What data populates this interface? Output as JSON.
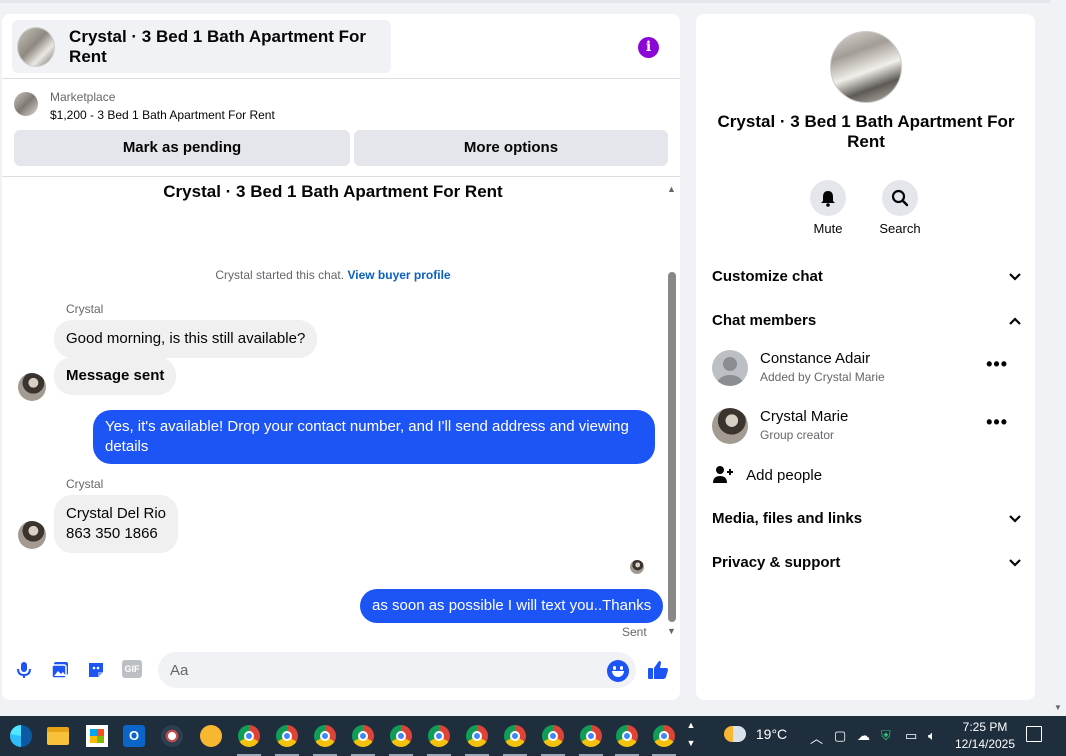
{
  "chat": {
    "header_title": "Crystal · 3 Bed 1 Bath Apartment For Rent",
    "listing_source": "Marketplace",
    "listing_price_title": "$1,200 - 3 Bed 1 Bath Apartment For Rent",
    "mark_pending_label": "Mark as pending",
    "more_options_label": "More options",
    "conversation_title": "Crystal · 3 Bed 1 Bath Apartment For Rent",
    "started_text": "Crystal started this chat.",
    "view_buyer_profile": "View buyer profile",
    "messages": [
      {
        "sender": "Crystal",
        "text": "Good morning, is this still available?"
      },
      {
        "text": "Message sent"
      },
      {
        "text": "Yes, it's available! Drop your contact number, and I'll send address and viewing details"
      },
      {
        "sender": "Crystal",
        "line1": "Crystal Del Rio",
        "line2": "863 350 1866"
      },
      {
        "text": "as soon as possible I will text you..Thanks"
      }
    ],
    "status": "Sent",
    "input_placeholder": "Aa",
    "composer_icons": [
      "microphone-icon",
      "photo-icon",
      "sticker-icon",
      "gif-icon",
      "emoji-icon",
      "thumbs-up-icon"
    ],
    "gif_label": "GIF",
    "accent_color": "#1d54f5",
    "info_color": "#8a07d6"
  },
  "info_panel": {
    "title": "Crystal · 3 Bed 1 Bath Apartment For Rent",
    "mute_label": "Mute",
    "search_label": "Search",
    "customize_chat": "Customize chat",
    "chat_members": "Chat members",
    "members": [
      {
        "name": "Constance Adair",
        "subtitle": "Added by Crystal Marie"
      },
      {
        "name": "Crystal Marie",
        "subtitle": "Group creator"
      }
    ],
    "add_people": "Add people",
    "media_files_links": "Media, files and links",
    "privacy_support": "Privacy & support"
  },
  "taskbar": {
    "weather": "19°C",
    "time": "7:25 PM",
    "date": "12/14/2025"
  }
}
